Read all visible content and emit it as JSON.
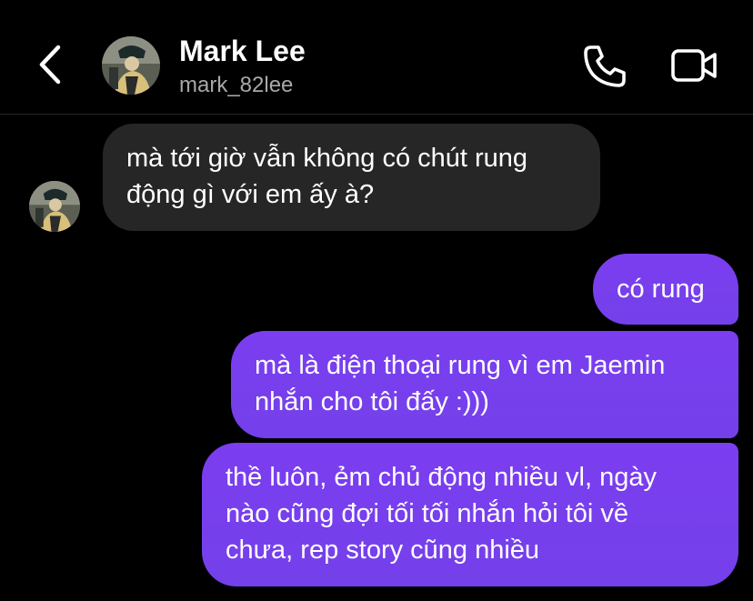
{
  "header": {
    "name": "Mark Lee",
    "handle": "mark_82lee",
    "back_icon": "chevron-left-icon",
    "call_icon": "phone-icon",
    "video_icon": "video-camera-icon"
  },
  "messages": [
    {
      "direction": "incoming",
      "lines": [
        "mà tới giờ vẫn không có chút rung",
        "động gì với em ấy à?"
      ]
    },
    {
      "direction": "outgoing",
      "lines": [
        "có rung"
      ]
    },
    {
      "direction": "outgoing",
      "lines": [
        "mà là điện thoại rung vì em Jaemin",
        "nhắn cho tôi đấy :)))"
      ]
    },
    {
      "direction": "outgoing",
      "lines": [
        "thề luôn, ẻm chủ động nhiều vl, ngày",
        "nào cũng đợi tối tối nhắn hỏi tôi về",
        "chưa, rep story cũng nhiều"
      ]
    }
  ],
  "colors": {
    "background": "#000000",
    "incoming_bubble": "#262626",
    "outgoing_bubble": "#7a3df0",
    "secondary_text": "#a8a8a8"
  }
}
